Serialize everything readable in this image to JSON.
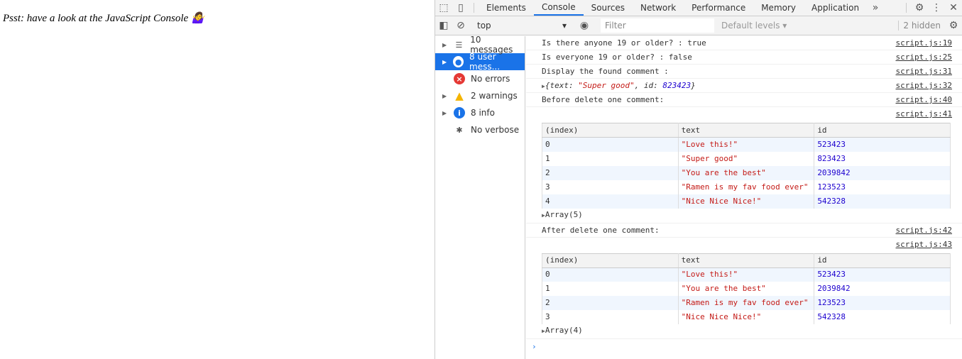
{
  "page": {
    "text": "Psst: have a look at the JavaScript Console 🤷‍♀️"
  },
  "tabs": [
    "Elements",
    "Console",
    "Sources",
    "Network",
    "Performance",
    "Memory",
    "Application"
  ],
  "toolbar": {
    "context": "top",
    "filter_placeholder": "Filter",
    "levels": "Default levels ▾",
    "hidden": "2 hidden"
  },
  "sidebar": [
    {
      "label": "10 messages"
    },
    {
      "label": "8 user mess..."
    },
    {
      "label": "No errors"
    },
    {
      "label": "2 warnings"
    },
    {
      "label": "8 info"
    },
    {
      "label": "No verbose"
    }
  ],
  "console": {
    "messages": [
      {
        "text": "Is there anyone 19 or older? : true",
        "src": "script.js:19"
      },
      {
        "text": "Is everyone 19 or older? : false",
        "src": "script.js:25"
      },
      {
        "text": "Display the found comment :",
        "src": "script.js:31"
      }
    ],
    "object": {
      "prefix": "{text: ",
      "text": "\"Super good\"",
      "mid": ", id: ",
      "id": "823423",
      "suffix": "}",
      "src": "script.js:32"
    },
    "before": {
      "text": "Before delete one comment:",
      "src": "script.js:40",
      "table_src": "script.js:41",
      "array": "Array(5)"
    },
    "after": {
      "text": "After delete one comment:",
      "src": "script.js:42",
      "table_src": "script.js:43",
      "array": "Array(4)"
    },
    "headers": [
      "(index)",
      "text",
      "id"
    ],
    "table1": [
      [
        "0",
        "\"Love this!\"",
        "523423"
      ],
      [
        "1",
        "\"Super good\"",
        "823423"
      ],
      [
        "2",
        "\"You are the best\"",
        "2039842"
      ],
      [
        "3",
        "\"Ramen is my fav food ever\"",
        "123523"
      ],
      [
        "4",
        "\"Nice Nice Nice!\"",
        "542328"
      ]
    ],
    "table2": [
      [
        "0",
        "\"Love this!\"",
        "523423"
      ],
      [
        "1",
        "\"You are the best\"",
        "2039842"
      ],
      [
        "2",
        "\"Ramen is my fav food ever\"",
        "123523"
      ],
      [
        "3",
        "\"Nice Nice Nice!\"",
        "542328"
      ]
    ],
    "prompt": "›"
  }
}
